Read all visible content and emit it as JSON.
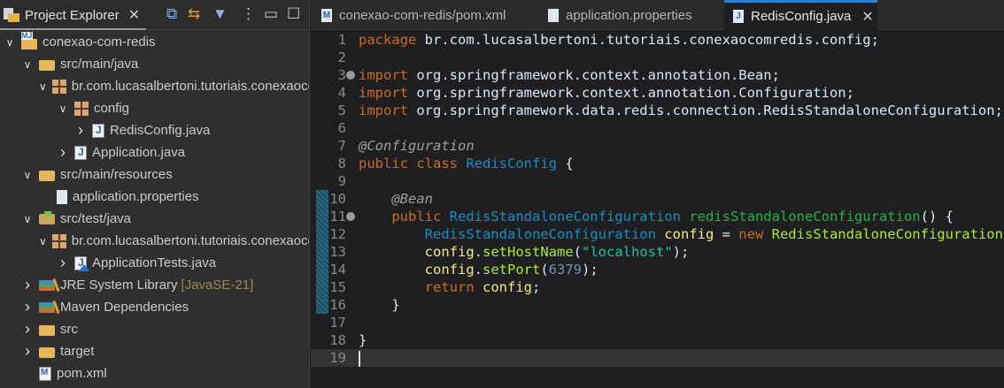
{
  "explorer": {
    "title": "Project Explorer",
    "items": [
      {
        "level": 0,
        "arrow": "down",
        "icon": "proj",
        "label": "conexao-com-redis"
      },
      {
        "level": 1,
        "arrow": "down",
        "icon": "folder",
        "label": "src/main/java"
      },
      {
        "level": 2,
        "arrow": "down",
        "icon": "pkg",
        "label": "br.com.lucasalbertoni.tutoriais.conexaocomredis"
      },
      {
        "level": 3,
        "arrow": "down",
        "icon": "pkg",
        "label": "config"
      },
      {
        "level": 4,
        "arrow": "right",
        "icon": "java",
        "label": "RedisConfig.java"
      },
      {
        "level": 3,
        "arrow": "right",
        "icon": "java",
        "label": "Application.java"
      },
      {
        "level": 1,
        "arrow": "down",
        "icon": "folder",
        "label": "src/main/resources"
      },
      {
        "level": 2,
        "arrow": "none",
        "icon": "props",
        "label": "application.properties"
      },
      {
        "level": 1,
        "arrow": "down",
        "icon": "srcfolder",
        "label": "src/test/java"
      },
      {
        "level": 2,
        "arrow": "down",
        "icon": "pkg",
        "label": "br.com.lucasalbertoni.tutoriais.conexaocomredis"
      },
      {
        "level": 3,
        "arrow": "right",
        "icon": "java test",
        "label": "ApplicationTests.java"
      },
      {
        "level": 1,
        "arrow": "right",
        "icon": "lib",
        "label": "JRE System Library",
        "deco": "[JavaSE-21]"
      },
      {
        "level": 1,
        "arrow": "right",
        "icon": "lib",
        "label": "Maven Dependencies"
      },
      {
        "level": 1,
        "arrow": "right",
        "icon": "folder",
        "label": "src"
      },
      {
        "level": 1,
        "arrow": "right",
        "icon": "folder",
        "label": "target"
      },
      {
        "level": 1,
        "arrow": "none",
        "icon": "pom",
        "label": "pom.xml"
      }
    ]
  },
  "tabs": [
    {
      "label": "conexao-com-redis/pom.xml",
      "icon": "M"
    },
    {
      "label": "application.properties",
      "icon": ""
    },
    {
      "label": "RedisConfig.java",
      "icon": "J",
      "active": true
    }
  ],
  "code": [
    [
      [
        "package",
        "kw"
      ],
      [
        " br.com.lucasalbertoni.tutoriais.conexaocomredis.config;",
        "pl"
      ]
    ],
    [],
    [
      [
        "import",
        "kw"
      ],
      [
        " org.springframework.context.annotation.Bean;",
        "pl"
      ]
    ],
    [
      [
        "import",
        "kw"
      ],
      [
        " org.springframework.context.annotation.Configuration;",
        "pl"
      ]
    ],
    [
      [
        "import",
        "kw"
      ],
      [
        " org.springframework.data.redis.connection.RedisStandaloneConfiguration;",
        "pl"
      ]
    ],
    [],
    [
      [
        "@Configuration",
        "an"
      ]
    ],
    [
      [
        "public",
        "kw"
      ],
      [
        " ",
        "pl"
      ],
      [
        "class",
        "kw"
      ],
      [
        " ",
        "pl"
      ],
      [
        "RedisConfig",
        "ty"
      ],
      [
        " {",
        "pl"
      ]
    ],
    [],
    [
      [
        "    ",
        "pl"
      ],
      [
        "@Bean",
        "an"
      ]
    ],
    [
      [
        "    ",
        "pl"
      ],
      [
        "public",
        "kw"
      ],
      [
        " ",
        "pl"
      ],
      [
        "RedisStandaloneConfiguration",
        "ty"
      ],
      [
        " ",
        "pl"
      ],
      [
        "redisStandaloneConfiguration",
        "md"
      ],
      [
        "() {",
        "pl"
      ]
    ],
    [
      [
        "        ",
        "pl"
      ],
      [
        "RedisStandaloneConfiguration",
        "ty"
      ],
      [
        " ",
        "pl"
      ],
      [
        "config",
        "var"
      ],
      [
        " = ",
        "pl"
      ],
      [
        "new",
        "kw"
      ],
      [
        " ",
        "pl"
      ],
      [
        "RedisStandaloneConfiguration",
        "mc"
      ],
      [
        "();",
        "pl"
      ]
    ],
    [
      [
        "        ",
        "pl"
      ],
      [
        "config",
        "var"
      ],
      [
        ".",
        "pl"
      ],
      [
        "setHostName",
        "mc"
      ],
      [
        "(",
        "pl"
      ],
      [
        "\"localhost\"",
        "st"
      ],
      [
        ");",
        "pl"
      ]
    ],
    [
      [
        "        ",
        "pl"
      ],
      [
        "config",
        "var"
      ],
      [
        ".",
        "pl"
      ],
      [
        "setPort",
        "mc"
      ],
      [
        "(",
        "pl"
      ],
      [
        "6379",
        "nu"
      ],
      [
        ");",
        "pl"
      ]
    ],
    [
      [
        "        ",
        "pl"
      ],
      [
        "return",
        "kw"
      ],
      [
        " ",
        "pl"
      ],
      [
        "config",
        "var"
      ],
      [
        ";",
        "pl"
      ]
    ],
    [
      [
        "    }",
        "pl"
      ]
    ],
    [],
    [
      [
        "}",
        "pl"
      ]
    ],
    []
  ],
  "fold_lines": [
    3,
    11
  ],
  "current_line": 19
}
